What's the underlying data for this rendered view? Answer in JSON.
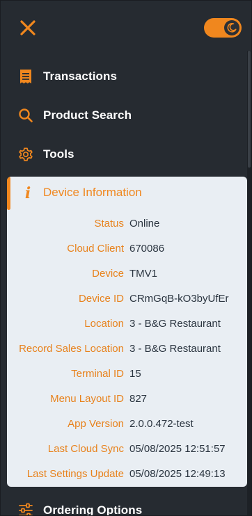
{
  "colors": {
    "accent": "#f0871e",
    "sidebar_bg": "#262b31",
    "panel_bg": "#e9eef3",
    "value_text": "#2b3540"
  },
  "header": {
    "close_icon": "close-icon",
    "theme_toggle_state": "dark",
    "theme_icon": "moon-icon"
  },
  "nav": {
    "transactions": {
      "label": "Transactions",
      "icon": "receipt-icon"
    },
    "product_search": {
      "label": "Product Search",
      "icon": "search-icon"
    },
    "tools": {
      "label": "Tools",
      "icon": "gear-icon"
    },
    "ordering_options": {
      "label": "Ordering Options",
      "icon": "sliders-icon"
    }
  },
  "device_info": {
    "title": "Device Information",
    "icon": "info-icon",
    "rows": [
      {
        "label": "Status",
        "value": "Online"
      },
      {
        "label": "Cloud Client",
        "value": "670086"
      },
      {
        "label": "Device",
        "value": "TMV1"
      },
      {
        "label": "Device ID",
        "value": "CRmGqB-kO3byUfEr"
      },
      {
        "label": "Location",
        "value": "3 - B&G Restaurant"
      },
      {
        "label": "Record Sales Location",
        "value": "3 - B&G Restaurant"
      },
      {
        "label": "Terminal ID",
        "value": "15"
      },
      {
        "label": "Menu Layout ID",
        "value": "827"
      },
      {
        "label": "App Version",
        "value": "2.0.0.472-test"
      },
      {
        "label": "Last Cloud Sync",
        "value": "05/08/2025 12:51:57"
      },
      {
        "label": "Last Settings Update",
        "value": "05/08/2025 12:49:13"
      }
    ]
  }
}
